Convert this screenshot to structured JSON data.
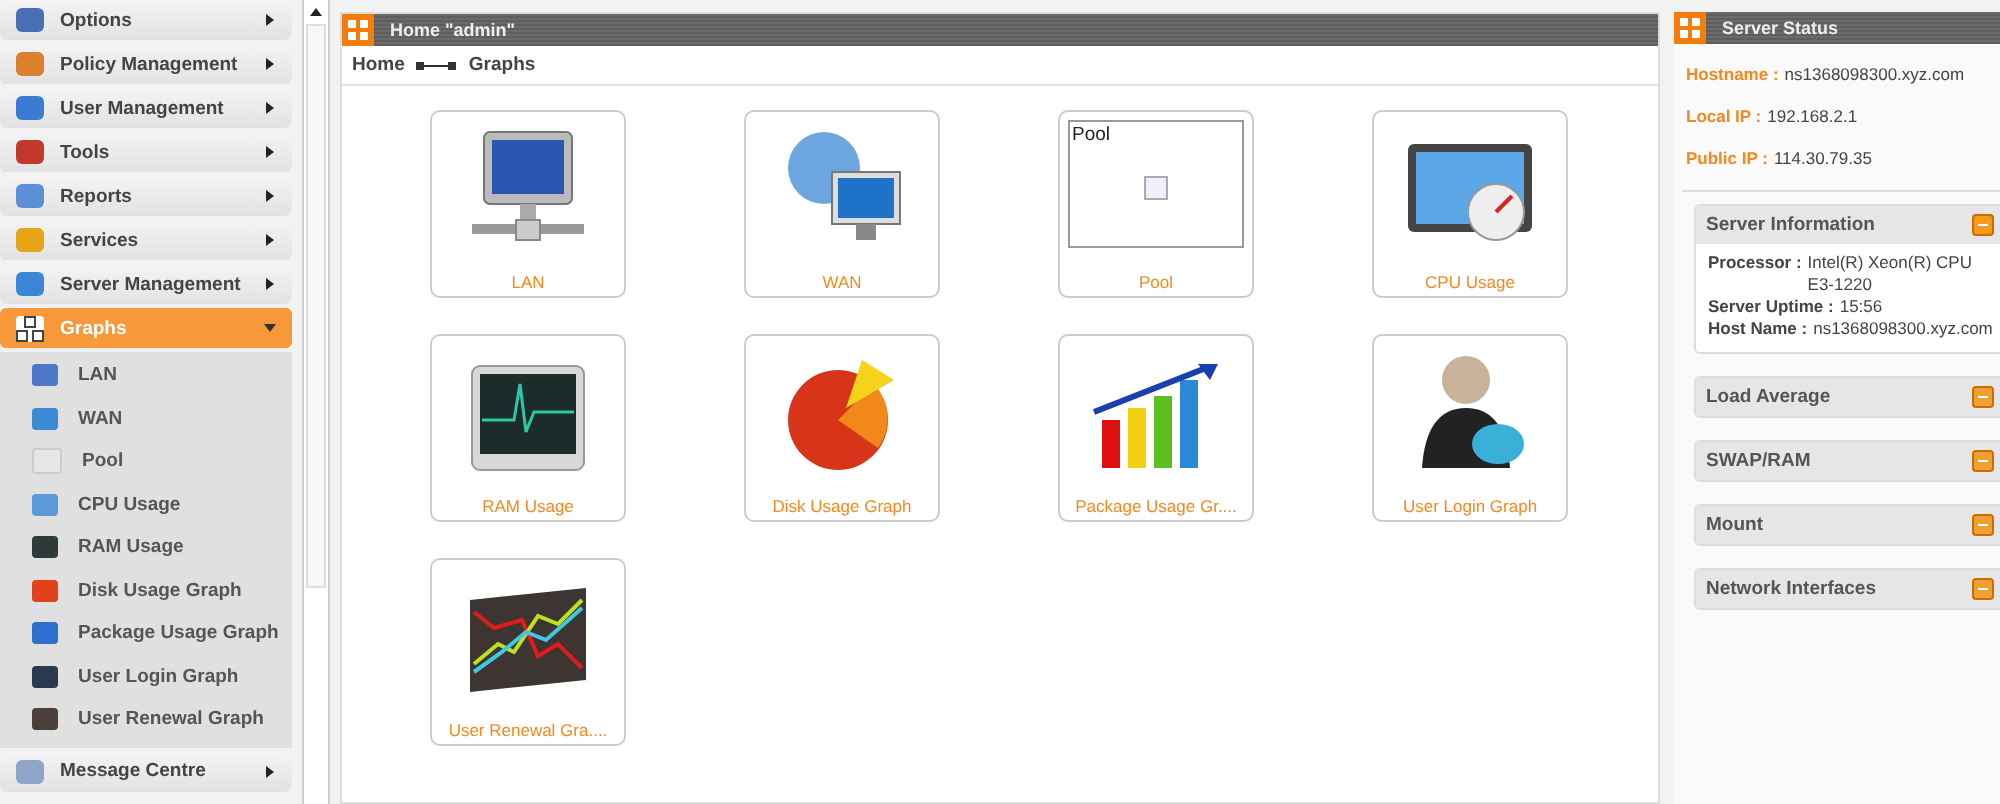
{
  "sidebar": {
    "items": [
      {
        "label": "Options",
        "expanded": false
      },
      {
        "label": "Policy Management",
        "expanded": false
      },
      {
        "label": "User Management",
        "expanded": false
      },
      {
        "label": "Tools",
        "expanded": false
      },
      {
        "label": "Reports",
        "expanded": false
      },
      {
        "label": "Services",
        "expanded": false
      },
      {
        "label": "Server Management",
        "expanded": false
      },
      {
        "label": "Graphs",
        "expanded": true,
        "children": [
          {
            "label": "LAN"
          },
          {
            "label": "WAN"
          },
          {
            "label": "Pool"
          },
          {
            "label": "CPU Usage"
          },
          {
            "label": "RAM Usage"
          },
          {
            "label": "Disk Usage Graph"
          },
          {
            "label": "Package Usage Graph"
          },
          {
            "label": "User Login Graph"
          },
          {
            "label": "User Renewal Graph"
          }
        ]
      },
      {
        "label": "Message Centre",
        "expanded": false
      }
    ]
  },
  "main": {
    "title": "Home \"admin\"",
    "breadcrumb": [
      "Home",
      "Graphs"
    ],
    "tiles": [
      {
        "label": "LAN",
        "kind": "lan"
      },
      {
        "label": "WAN",
        "kind": "wan"
      },
      {
        "label": "Pool",
        "kind": "broken",
        "alt_text": "Pool"
      },
      {
        "label": "CPU Usage",
        "kind": "cpu"
      },
      {
        "label": "RAM Usage",
        "kind": "ram"
      },
      {
        "label": "Disk Usage Graph",
        "kind": "disk"
      },
      {
        "label": "Package Usage Gr....",
        "kind": "package"
      },
      {
        "label": "User Login Graph",
        "kind": "login"
      },
      {
        "label": "User Renewal Gra....",
        "kind": "renewal"
      }
    ]
  },
  "server_status": {
    "title": "Server Status",
    "fields": [
      {
        "label": "Hostname :",
        "value": "ns1368098300.xyz.com"
      },
      {
        "label": "Local IP :",
        "value": "192.168.2.1"
      },
      {
        "label": "Public IP :",
        "value": "114.30.79.35"
      }
    ],
    "sections": [
      {
        "title": "Server Information",
        "expanded": true,
        "lines": [
          {
            "label": "Processor :",
            "value": "Intel(R) Xeon(R) CPU E3-1220"
          },
          {
            "label": "Server Uptime :",
            "value": "15:56"
          },
          {
            "label": "Host Name :",
            "value": "ns1368098300.xyz.com"
          }
        ]
      },
      {
        "title": "Load Average",
        "expanded": false
      },
      {
        "title": "SWAP/RAM",
        "expanded": false
      },
      {
        "title": "Mount",
        "expanded": false
      },
      {
        "title": "Network Interfaces",
        "expanded": false
      }
    ]
  }
}
